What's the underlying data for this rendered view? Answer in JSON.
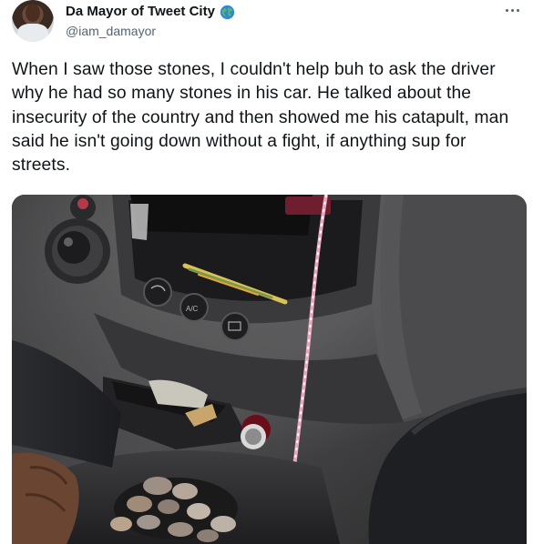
{
  "author": {
    "display_name": "Da Mayor of Tweet City",
    "handle": "@iam_damayor",
    "globe_icon": "globe-icon"
  },
  "tweet": {
    "text": "When I saw those stones, I couldn't help buh to ask the driver why he had so many stones in his car. He talked about the insecurity of the country and then showed me his catapult, man said he isn't going down without a fight, if anything sup for streets."
  },
  "media": {
    "button_labels": [
      "A/C"
    ]
  },
  "colors": {
    "text": "#0f1419",
    "secondary": "#536471"
  }
}
